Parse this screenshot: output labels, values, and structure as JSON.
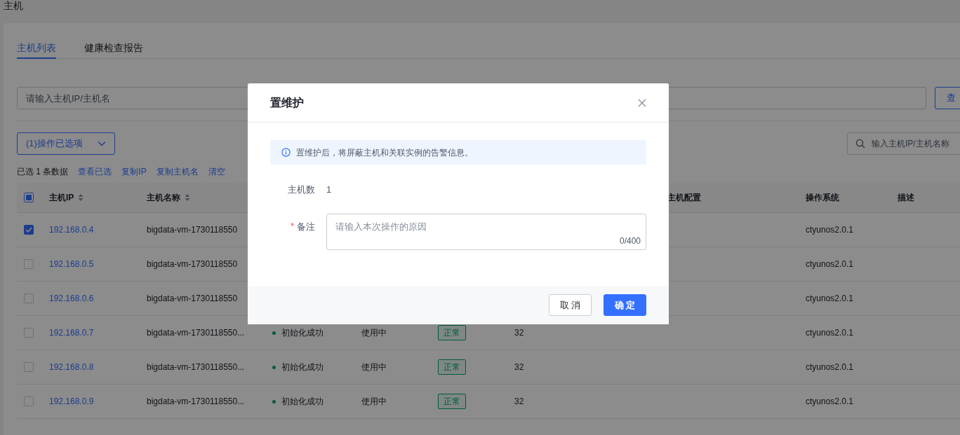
{
  "page_title": "主机",
  "tabs": [
    {
      "label": "主机列表",
      "selected": true
    },
    {
      "label": "健康检查报告",
      "selected": false
    }
  ],
  "search": {
    "placeholder": "请输入主机IP/主机名",
    "button": "查"
  },
  "bulk_action": {
    "label": "(1)操作已选项"
  },
  "table_search": {
    "placeholder": "输入主机IP/主机名称"
  },
  "selection": {
    "summary": "已选 1 条数据",
    "links": [
      "查看已选",
      "复制IP",
      "复制主机名",
      "清空"
    ]
  },
  "table": {
    "select_all": {
      "indeterminate": true
    },
    "header": {
      "ip": {
        "label": "主机IP",
        "sortable": true
      },
      "host_name": {
        "label": "主机名称",
        "sortable": true
      },
      "config": {
        "label": "主机配置"
      },
      "os": {
        "label": "操作系统"
      },
      "description": {
        "label": "描述"
      }
    },
    "rows": [
      {
        "checked": true,
        "ip": "192.168.0.4",
        "host_name": "bigdata-vm-1730118550",
        "os": "ctyunos2.0.1"
      },
      {
        "checked": false,
        "ip": "192.168.0.5",
        "host_name": "bigdata-vm-1730118550",
        "os": "ctyunos2.0.1"
      },
      {
        "checked": false,
        "ip": "192.168.0.6",
        "host_name": "bigdata-vm-1730118550",
        "os": "ctyunos2.0.1"
      },
      {
        "checked": false,
        "ip": "192.168.0.7",
        "host_name": "bigdata-vm-1730118550...",
        "init_status": "初始化成功",
        "usage": "使用中",
        "health": "正常",
        "column_7": "32",
        "os": "ctyunos2.0.1"
      },
      {
        "checked": false,
        "ip": "192.168.0.8",
        "host_name": "bigdata-vm-1730118550...",
        "init_status": "初始化成功",
        "usage": "使用中",
        "health": "正常",
        "column_7": "32",
        "os": "ctyunos2.0.1"
      },
      {
        "checked": false,
        "ip": "192.168.0.9",
        "host_name": "bigdata-vm-1730118550...",
        "init_status": "初始化成功",
        "usage": "使用中",
        "health": "正常",
        "column_7": "32",
        "os": "ctyunos2.0.1"
      }
    ]
  },
  "dialog": {
    "title": "置维护",
    "notice": "置维护后，将屏蔽主机和关联实例的告警信息。",
    "fields": [
      {
        "kind": "static",
        "label": "主机数",
        "value": "1"
      },
      {
        "kind": "textarea",
        "required_mark": "*",
        "label": "备注",
        "placeholder": "请输入本次操作的原因",
        "counter": "0/400"
      }
    ],
    "buttons": [
      {
        "kind": "secondary",
        "label": "取 消"
      },
      {
        "kind": "primary",
        "label": "确 定"
      }
    ]
  }
}
